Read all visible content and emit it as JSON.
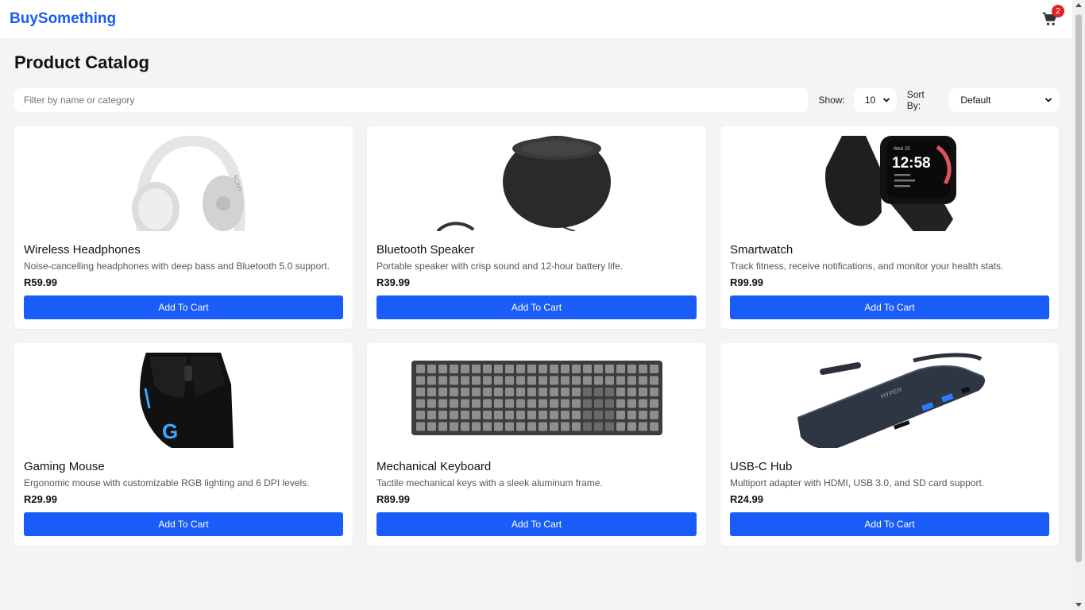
{
  "brand": "BuySomething",
  "cart": {
    "count": "2",
    "icon": "cart-icon",
    "badge_color": "#e02424"
  },
  "page_title": "Product Catalog",
  "controls": {
    "filter_placeholder": "Filter by name or category",
    "show_label": "Show:",
    "show_value": "10",
    "sort_label": "Sort By:",
    "sort_value": "Default"
  },
  "accent_color": "#1a5cf7",
  "products": [
    {
      "name": "Wireless Headphones",
      "description": "Noise-cancelling headphones with deep bass and Bluetooth 5.0 support.",
      "price": "R59.99",
      "button": "Add To Cart",
      "image": "headphones"
    },
    {
      "name": "Bluetooth Speaker",
      "description": "Portable speaker with crisp sound and 12-hour battery life.",
      "price": "R39.99",
      "button": "Add To Cart",
      "image": "speaker"
    },
    {
      "name": "Smartwatch",
      "description": "Track fitness, receive notifications, and monitor your health stats.",
      "price": "R99.99",
      "button": "Add To Cart",
      "image": "smartwatch"
    },
    {
      "name": "Gaming Mouse",
      "description": "Ergonomic mouse with customizable RGB lighting and 6 DPI levels.",
      "price": "R29.99",
      "button": "Add To Cart",
      "image": "mouse"
    },
    {
      "name": "Mechanical Keyboard",
      "description": "Tactile mechanical keys with a sleek aluminum frame.",
      "price": "R89.99",
      "button": "Add To Cart",
      "image": "keyboard"
    },
    {
      "name": "USB-C Hub",
      "description": "Multiport adapter with HDMI, USB 3.0, and SD card support.",
      "price": "R24.99",
      "button": "Add To Cart",
      "image": "usb-hub"
    }
  ],
  "watch_face": {
    "time": "12:58",
    "date": "Wed 25"
  },
  "hub_logo": "HYPER"
}
